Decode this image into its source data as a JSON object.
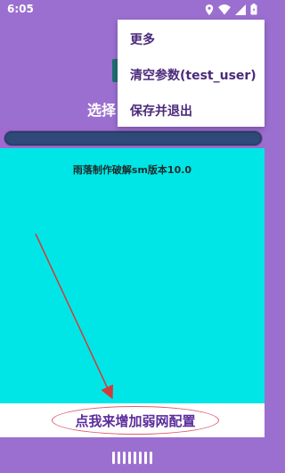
{
  "status": {
    "time": "6:05",
    "icons": [
      "location-icon",
      "wifi-icon",
      "signal-icon",
      "battery-icon"
    ]
  },
  "header": {
    "title": "选择"
  },
  "progress": {
    "value": 0
  },
  "main": {
    "version_text": "雨落制作破解sm版本10.0"
  },
  "action": {
    "config_label": "点我来增加弱网配置"
  },
  "menu": {
    "items": [
      {
        "label": "更多"
      },
      {
        "label": "清空参数(test_user)"
      },
      {
        "label": "保存并退出"
      }
    ]
  },
  "colors": {
    "background": "#9b6fd0",
    "cyan": "#00e6e6",
    "accent": "#5b2c9b",
    "arrow": "#d23b3b"
  }
}
